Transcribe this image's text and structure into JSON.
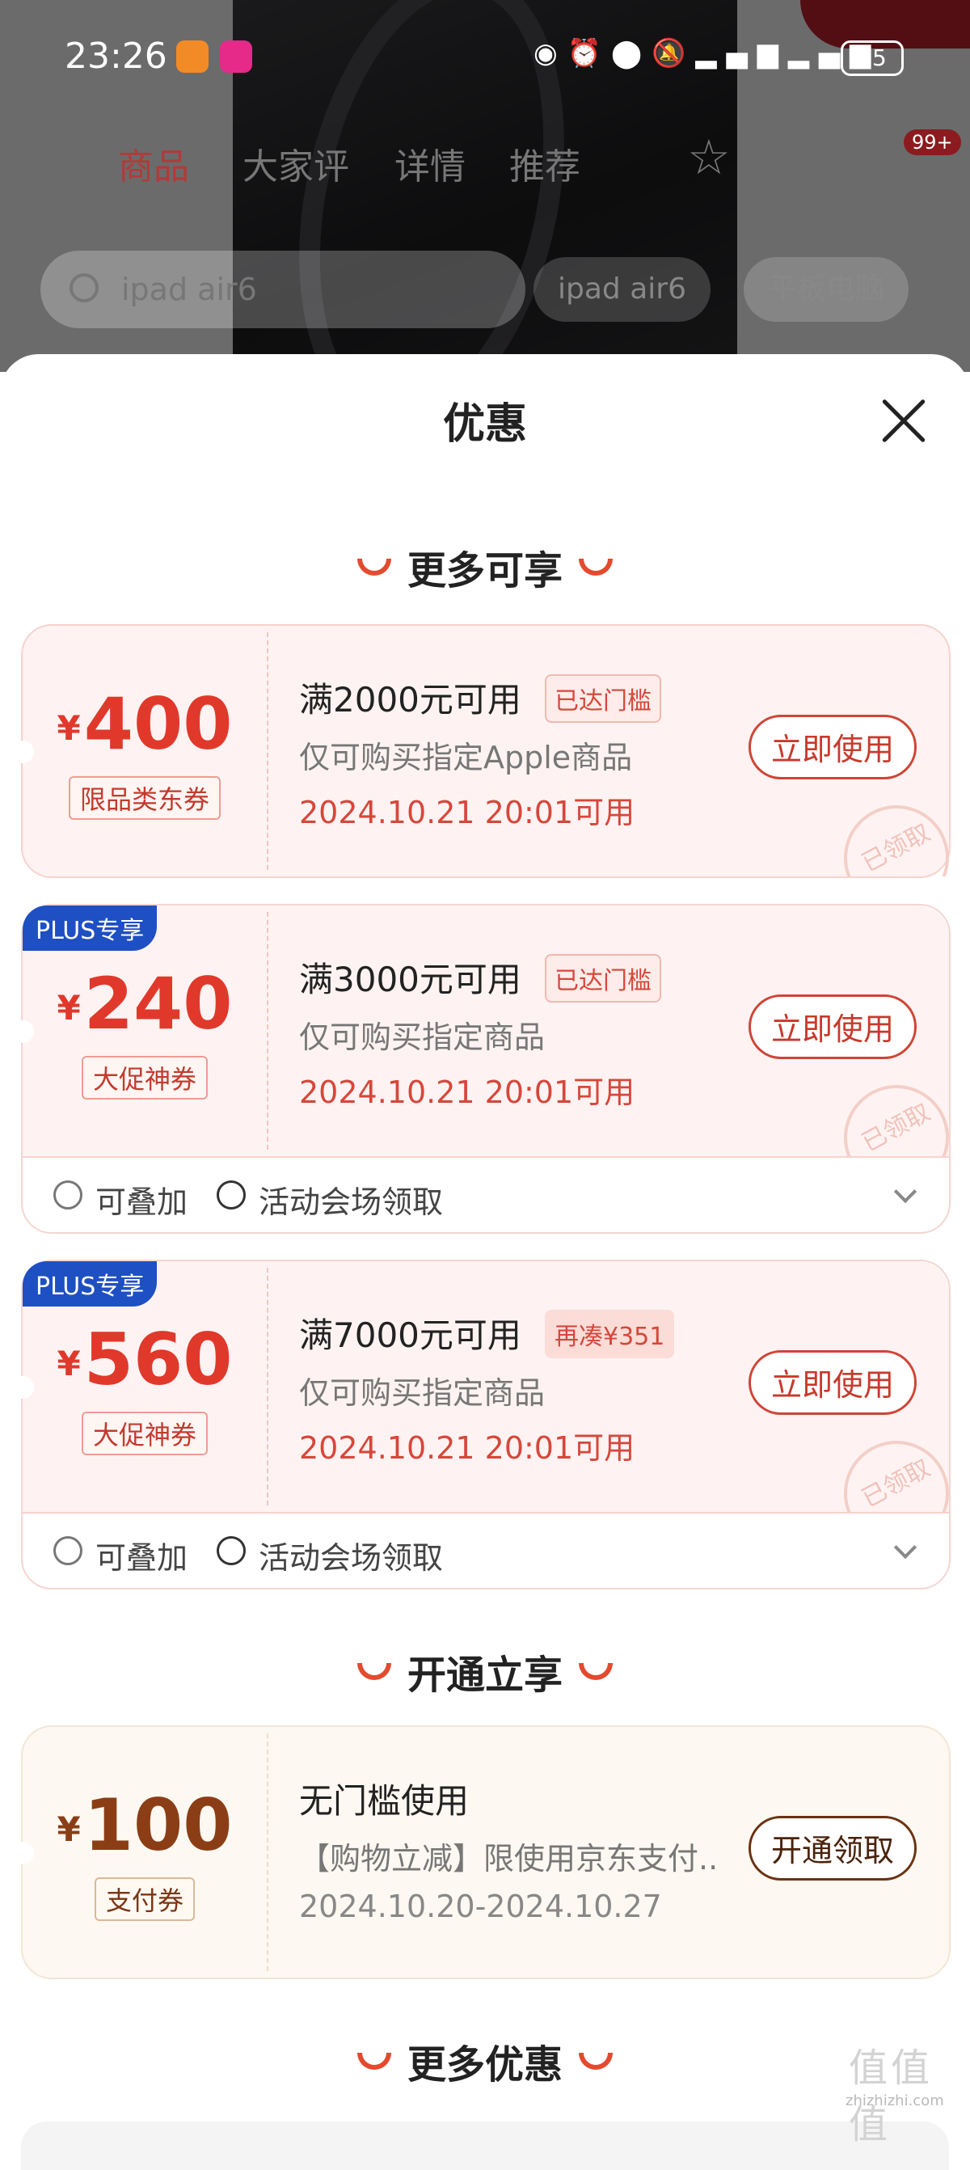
{
  "status_bar": {
    "time": "23:26",
    "icons": [
      "eye-icon",
      "alarm-icon",
      "location-icon",
      "mute-icon",
      "signal-5g-icon",
      "signal-5g-icon"
    ],
    "battery": "85"
  },
  "product_nav": {
    "tabs": [
      "商品",
      "大家评",
      "详情",
      "推荐"
    ],
    "active_tab": "商品",
    "badge": "99+"
  },
  "search": {
    "query": "ipad air6",
    "chip_left": "ipad air6",
    "chip_right": "平板电脑"
  },
  "sheet": {
    "title": "优惠"
  },
  "sections": {
    "more_available": "更多可享",
    "open_and_enjoy": "开通立享",
    "more_offers": "更多优惠"
  },
  "coupons": [
    {
      "currency": "¥",
      "amount": "400",
      "tag": "限品类东券",
      "plus_label": "",
      "condition": "满2000元可用",
      "badge": "已达门槛",
      "scope": "仅可购买指定Apple商品",
      "validity": "2024.10.21 20:01可用",
      "button": "立即使用",
      "stamp": "已领取"
    },
    {
      "currency": "¥",
      "amount": "240",
      "tag": "大促神券",
      "plus_label": "PLUS专享",
      "condition": "满3000元可用",
      "badge": "已达门槛",
      "scope": "仅可购买指定商品",
      "validity": "2024.10.21 20:01可用",
      "button": "立即使用",
      "stamp": "已领取",
      "footer": {
        "stackable": "可叠加",
        "source": "活动会场领取"
      }
    },
    {
      "currency": "¥",
      "amount": "560",
      "tag": "大促神券",
      "plus_label": "PLUS专享",
      "condition": "满7000元可用",
      "badge": "再凑¥351",
      "scope": "仅可购买指定商品",
      "validity": "2024.10.21 20:01可用",
      "button": "立即使用",
      "stamp": "已领取",
      "footer": {
        "stackable": "可叠加",
        "source": "活动会场领取"
      }
    },
    {
      "currency": "¥",
      "amount": "100",
      "tag": "支付券",
      "condition": "无门槛使用",
      "scope": "【购物立减】限使用京东支付...",
      "validity": "2024.10.20-2024.10.27",
      "button": "开通领取"
    }
  ],
  "watermark": {
    "big": "值值值",
    "small": "zhizhizhi.com"
  },
  "colors": {
    "accent_red": "#e0392b",
    "plus_blue": "#1e4fc3",
    "cream_brown": "#8b3e16"
  }
}
